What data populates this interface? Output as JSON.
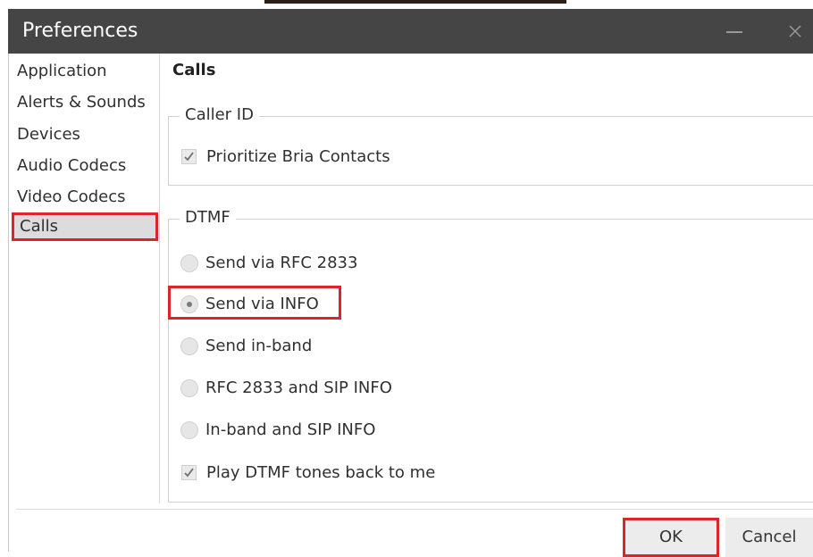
{
  "window": {
    "title": "Preferences",
    "minimize_icon": "minimize-icon",
    "close_icon": "close-icon"
  },
  "sidebar": {
    "items": [
      {
        "label": "Application",
        "selected": false
      },
      {
        "label": "Alerts & Sounds",
        "selected": false
      },
      {
        "label": "Devices",
        "selected": false
      },
      {
        "label": "Audio Codecs",
        "selected": false
      },
      {
        "label": "Video Codecs",
        "selected": false
      },
      {
        "label": "Calls",
        "selected": true
      }
    ]
  },
  "content": {
    "title": "Calls",
    "caller_id": {
      "legend": "Caller ID",
      "prioritize_contacts": {
        "label": "Prioritize Bria Contacts",
        "checked": true
      }
    },
    "dtmf": {
      "legend": "DTMF",
      "options": [
        {
          "label": "Send via RFC 2833",
          "selected": false
        },
        {
          "label": "Send via INFO",
          "selected": true
        },
        {
          "label": "Send in-band",
          "selected": false
        },
        {
          "label": "RFC 2833 and SIP INFO",
          "selected": false
        },
        {
          "label": "In-band and SIP INFO",
          "selected": false
        }
      ],
      "play_tones": {
        "label": "Play DTMF tones back to me",
        "checked": true
      }
    }
  },
  "footer": {
    "ok_label": "OK",
    "cancel_label": "Cancel"
  },
  "colors": {
    "titlebar": "#454545",
    "highlight": "#d9262b",
    "selected_bg": "#dcdcdc"
  }
}
